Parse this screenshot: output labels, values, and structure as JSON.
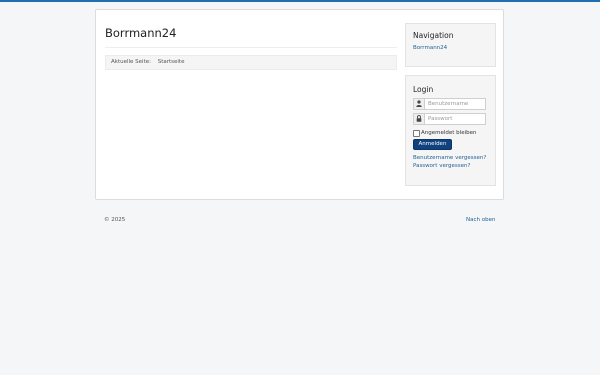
{
  "site": {
    "title": "Borrmann24"
  },
  "breadcrumb": {
    "label": "Aktuelle Seite:",
    "current": "Startseite"
  },
  "navigation": {
    "title": "Navigation",
    "items": [
      {
        "label": "Borrmann24"
      }
    ]
  },
  "login": {
    "title": "Login",
    "username_placeholder": "Benutzername",
    "password_placeholder": "Passwort",
    "remember_label": "Angemeldet bleiben",
    "submit_label": "Anmelden",
    "forgot_username": "Benutzername vergessen?",
    "forgot_password": "Passwort vergessen?"
  },
  "footer": {
    "copyright": "© 2025",
    "back_to_top": "Nach oben"
  },
  "colors": {
    "accent": "#1f6fb0",
    "button": "#10427f",
    "link": "#1f5f96"
  },
  "icons": {
    "username": "user-icon",
    "password": "lock-icon"
  }
}
